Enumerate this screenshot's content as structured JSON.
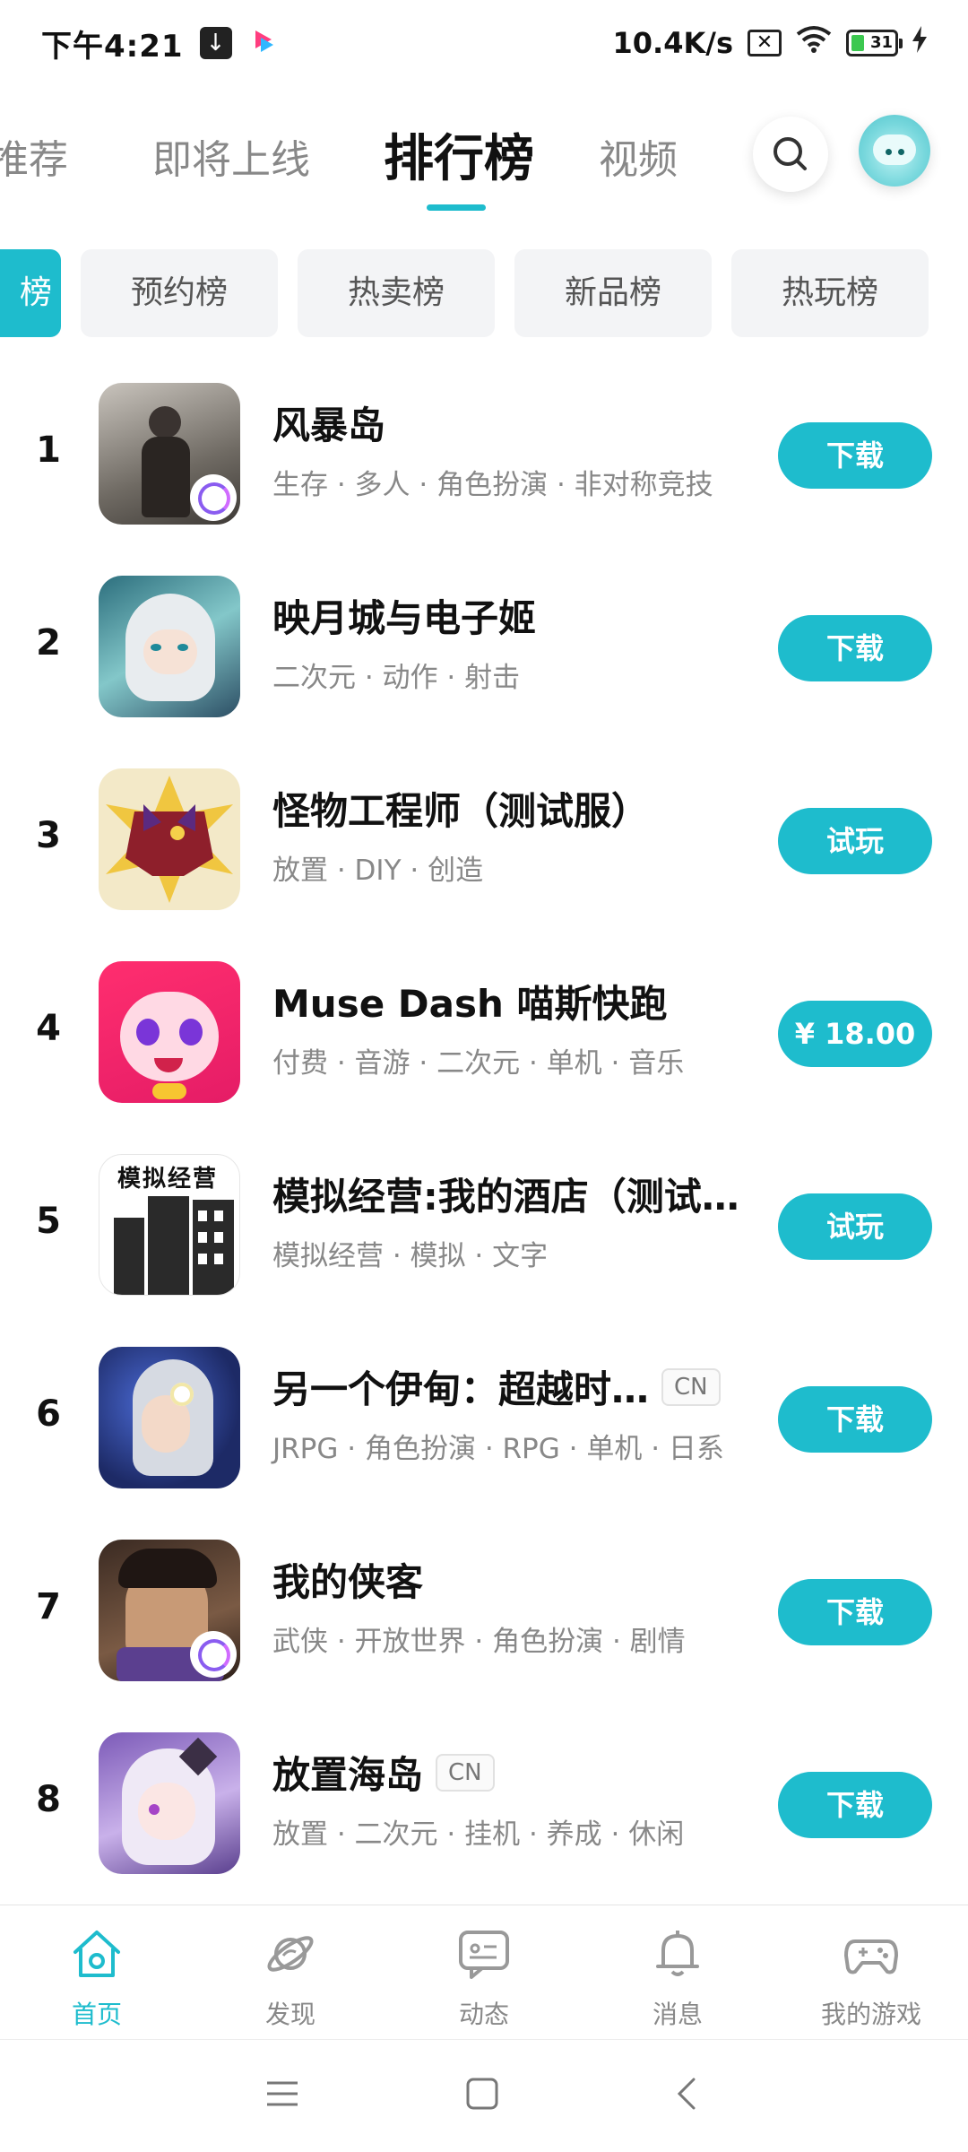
{
  "status_bar": {
    "time": "下午4:21",
    "net_speed": "10.4K/s",
    "battery": "31"
  },
  "top_tabs": [
    {
      "label": "推荐"
    },
    {
      "label": "即将上线"
    },
    {
      "label": "排行榜"
    },
    {
      "label": "视频"
    }
  ],
  "sub_tabs": [
    {
      "label": "榜"
    },
    {
      "label": "预约榜"
    },
    {
      "label": "热卖榜"
    },
    {
      "label": "新品榜"
    },
    {
      "label": "热玩榜"
    }
  ],
  "games": [
    {
      "rank": "1",
      "title": "风暴岛",
      "tags": "生存 · 多人 · 角色扮演 · 非对称竞技",
      "action": "下载"
    },
    {
      "rank": "2",
      "title": "映月城与电子姬",
      "tags": "二次元 · 动作 · 射击",
      "action": "下载"
    },
    {
      "rank": "3",
      "title": "怪物工程师（测试服）",
      "tags": "放置 · DIY · 创造",
      "action": "试玩"
    },
    {
      "rank": "4",
      "title": "Muse Dash 喵斯快跑",
      "tags": "付费 · 音游 · 二次元 · 单机 · 音乐",
      "action": "¥ 18.00"
    },
    {
      "rank": "5",
      "title": "模拟经营:我的酒店（测试…",
      "tags": "模拟经营 · 模拟 · 文字",
      "action": "试玩",
      "icon_text": "模拟经营"
    },
    {
      "rank": "6",
      "title": "另一个伊甸：超越时…",
      "badge": "CN",
      "tags": "JRPG · 角色扮演 · RPG · 单机 · 日系",
      "action": "下载"
    },
    {
      "rank": "7",
      "title": "我的侠客",
      "tags": "武侠 · 开放世界 · 角色扮演 · 剧情",
      "action": "下载"
    },
    {
      "rank": "8",
      "title": "放置海岛",
      "badge": "CN",
      "tags": "放置 · 二次元 · 挂机 · 养成 · 休闲",
      "action": "下载"
    }
  ],
  "bottom_nav": [
    {
      "label": "首页",
      "icon": "home-icon"
    },
    {
      "label": "发现",
      "icon": "planet-icon"
    },
    {
      "label": "动态",
      "icon": "chat-icon"
    },
    {
      "label": "消息",
      "icon": "bell-icon"
    },
    {
      "label": "我的游戏",
      "icon": "gamepad-icon"
    }
  ],
  "colors": {
    "accent": "#1ebccd",
    "text": "#111111",
    "muted": "#888888"
  }
}
